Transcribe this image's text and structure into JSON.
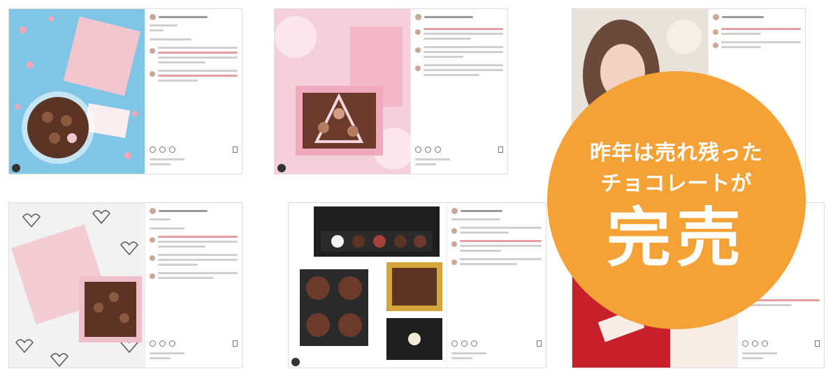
{
  "badge": {
    "line1": "昨年は売れ残った",
    "line2": "チョコレートが",
    "line3": "完売"
  },
  "colors": {
    "badge": "#f4a236",
    "card1_photo_bg": "#7fc6e6",
    "card2_photo_bg": "#f6cfdc",
    "card3_photo_bg": "#e9e2da",
    "card4_photo_bg": "#f2f2f2",
    "card5_photo_bg": "#ffffff",
    "card6_photo_bg": "#c8202b",
    "packaging_pink": "#f3c6cf",
    "chocolate": "#5b3424"
  }
}
